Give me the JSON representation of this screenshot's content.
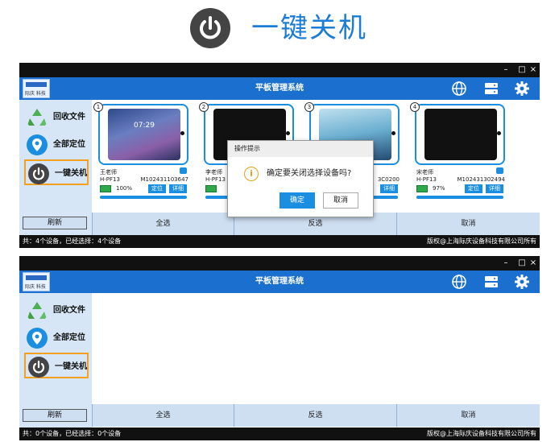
{
  "hero": {
    "title": "一键关机"
  },
  "window_controls": {
    "minimize": "–",
    "maximize": "□",
    "close": "×"
  },
  "app": {
    "title": "平板管理系统",
    "logo_text": "际庆 科技"
  },
  "sidebar": {
    "items": [
      {
        "label": "回收文件"
      },
      {
        "label": "全部定位"
      },
      {
        "label": "一键关机"
      }
    ],
    "refresh_label": "刷新"
  },
  "bottombar": {
    "select_all": "全选",
    "invert": "反选",
    "cancel": "取消"
  },
  "window1": {
    "status_left": "共：4个设备，已经选择：4个设备",
    "status_right": "版权@上海际庆设备科技有限公司所有",
    "devices": [
      {
        "num": "1",
        "user": "王老师",
        "model": "H-PF13",
        "sn": "M102431103647",
        "battery": "100%",
        "time": "07:29",
        "locate": "定位",
        "detail": "详细"
      },
      {
        "num": "2",
        "user": "李老师",
        "model": "H-PF13",
        "sn": "",
        "battery": "",
        "time": "",
        "locate": "定位",
        "detail": "详细"
      },
      {
        "num": "3",
        "user": "",
        "model": "",
        "sn": "3C0200",
        "battery": "",
        "time": "",
        "locate": "定位",
        "detail": "详细"
      },
      {
        "num": "4",
        "user": "宋老师",
        "model": "H-PF13",
        "sn": "M102431302494",
        "battery": "97%",
        "time": "",
        "locate": "定位",
        "detail": "详细"
      }
    ]
  },
  "dialog": {
    "title": "操作提示",
    "message": "确定要关闭选择设备吗?",
    "ok_label": "确定",
    "cancel_label": "取消"
  },
  "window2": {
    "status_left": "共：0个设备，已经选择：0个设备",
    "status_right": "版权@上海际庆设备科技有限公司所有"
  },
  "colors": {
    "accent": "#1a8ee0",
    "appbar": "#1a6fcf",
    "highlight": "#f3a11f"
  }
}
